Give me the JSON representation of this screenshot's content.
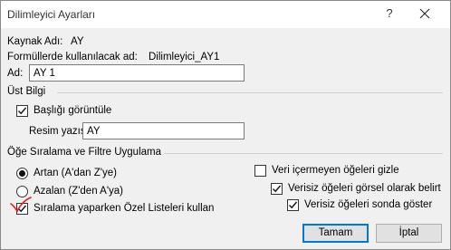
{
  "window": {
    "title": "Dilimleyici Ayarları",
    "help_label": "?"
  },
  "source": {
    "label": "Kaynak Adı:",
    "value": "AY"
  },
  "formula": {
    "label": "Formüllerde kullanılacak ad:",
    "value": "Dilimleyici_AY1"
  },
  "name": {
    "label": "Ad:",
    "value": "AY 1"
  },
  "header": {
    "section_title": "Üst Bilgi",
    "show_header_label": "Başlığı görüntüle",
    "show_header_checked": true,
    "caption_label": "Resim yazısı:",
    "caption_value": "AY"
  },
  "sorting": {
    "section_title": "Öğe Sıralama ve Filtre Uygulama",
    "ascending_label": "Artan (A'dan Z'ye)",
    "ascending_selected": true,
    "descending_label": "Azalan (Z'den A'ya)",
    "descending_selected": false,
    "custom_lists_label": "Sıralama yaparken Özel Listeleri kullan",
    "custom_lists_checked": true
  },
  "filtering": {
    "hide_no_data_label": "Veri içermeyen öğeleri gizle",
    "hide_no_data_checked": false,
    "indicate_no_data_label": "Verisiz öğeleri görsel olarak belirt",
    "indicate_no_data_checked": true,
    "show_last_label": "Verisiz öğeleri sonda göster",
    "show_last_checked": true
  },
  "buttons": {
    "ok_label": "Tamam",
    "cancel_label": "İptal"
  },
  "colors": {
    "accent": "#0078d7",
    "annotation": "#e02020"
  }
}
